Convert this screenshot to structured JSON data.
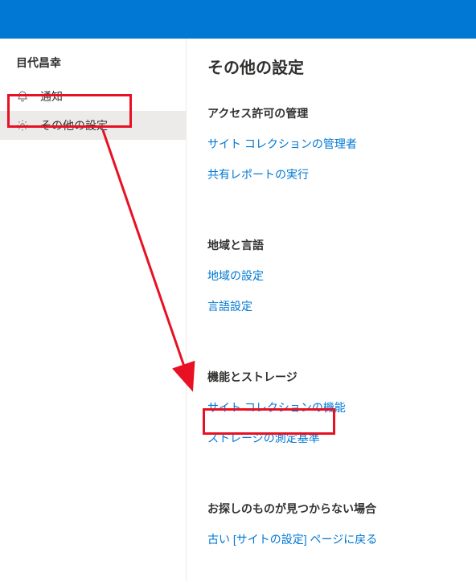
{
  "sidebar": {
    "user_name": "目代昌幸",
    "items": [
      {
        "icon": "bell",
        "label": "通知"
      },
      {
        "icon": "gear",
        "label": "その他の設定"
      }
    ]
  },
  "main": {
    "title": "その他の設定",
    "sections": [
      {
        "heading": "アクセス許可の管理",
        "links": [
          "サイト コレクションの管理者",
          "共有レポートの実行"
        ]
      },
      {
        "heading": "地域と言語",
        "links": [
          "地域の設定",
          "言語設定"
        ]
      },
      {
        "heading": "機能とストレージ",
        "links": [
          "サイト コレクションの機能",
          "ストレージの測定基準"
        ]
      },
      {
        "heading": "お探しのものが見つからない場合",
        "links": [
          "古い [サイトの設定] ページに戻る"
        ]
      }
    ]
  },
  "annotations": {
    "highlight_color": "#e81123"
  }
}
